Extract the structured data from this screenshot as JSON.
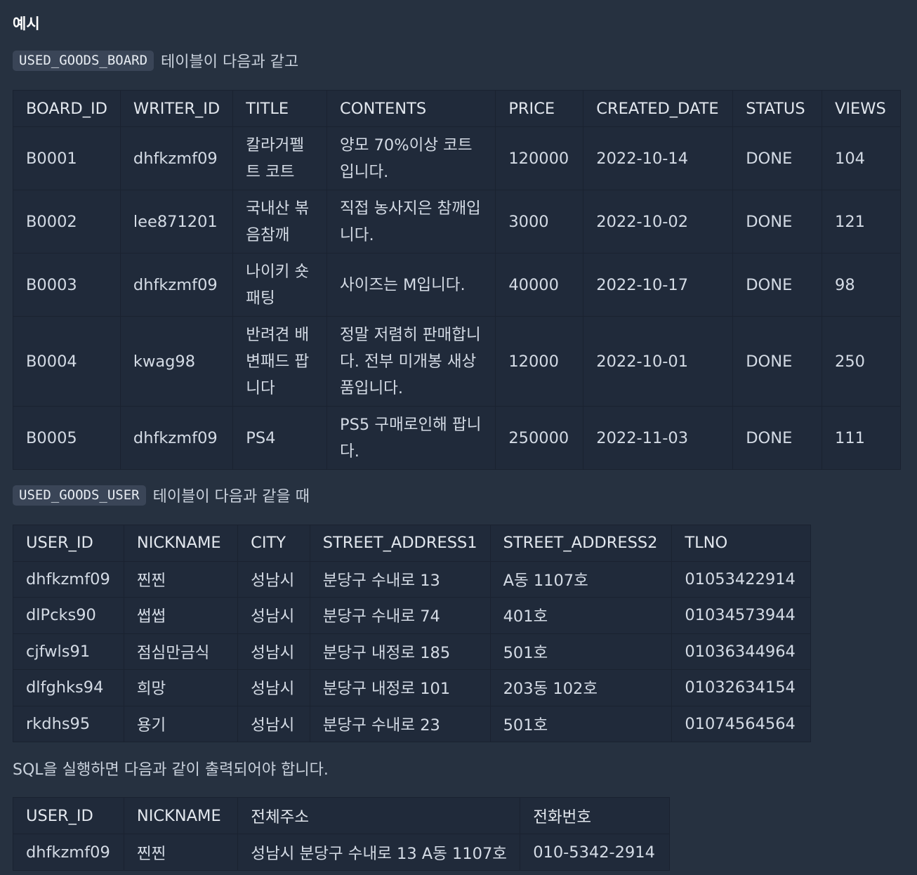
{
  "heading": "예시",
  "intro1": {
    "code": "USED_GOODS_BOARD",
    "text": "테이블이 다음과 같고"
  },
  "board_table": {
    "headers": [
      "BOARD_ID",
      "WRITER_ID",
      "TITLE",
      "CONTENTS",
      "PRICE",
      "CREATED_DATE",
      "STATUS",
      "VIEWS"
    ],
    "rows": [
      [
        "B0001",
        "dhfkzmf09",
        "칼라거펠트 코트",
        "양모 70%이상 코트입니다.",
        "120000",
        "2022-10-14",
        "DONE",
        "104"
      ],
      [
        "B0002",
        "lee871201",
        "국내산 볶음참깨",
        "직접 농사지은 참깨입니다.",
        "3000",
        "2022-10-02",
        "DONE",
        "121"
      ],
      [
        "B0003",
        "dhfkzmf09",
        "나이키 숏패팅",
        "사이즈는 M입니다.",
        "40000",
        "2022-10-17",
        "DONE",
        "98"
      ],
      [
        "B0004",
        "kwag98",
        "반려견 배변패드 팝니다",
        "정말 저렴히 판매합니다. 전부 미개봉 새상품입니다.",
        "12000",
        "2022-10-01",
        "DONE",
        "250"
      ],
      [
        "B0005",
        "dhfkzmf09",
        "PS4",
        "PS5 구매로인해 팝니다.",
        "250000",
        "2022-11-03",
        "DONE",
        "111"
      ]
    ]
  },
  "intro2": {
    "code": "USED_GOODS_USER",
    "text": "테이블이 다음과 같을 때"
  },
  "user_table": {
    "headers": [
      "USER_ID",
      "NICKNAME",
      "CITY",
      "STREET_ADDRESS1",
      "STREET_ADDRESS2",
      "TLNO"
    ],
    "rows": [
      [
        "dhfkzmf09",
        "찐찐",
        "성남시",
        "분당구 수내로 13",
        "A동 1107호",
        "01053422914"
      ],
      [
        "dlPcks90",
        "썹썹",
        "성남시",
        "분당구 수내로 74",
        "401호",
        "01034573944"
      ],
      [
        "cjfwls91",
        "점심만금식",
        "성남시",
        "분당구 내정로 185",
        "501호",
        "01036344964"
      ],
      [
        "dlfghks94",
        "희망",
        "성남시",
        "분당구 내정로 101",
        "203동 102호",
        "01032634154"
      ],
      [
        "rkdhs95",
        "용기",
        "성남시",
        "분당구 수내로 23",
        "501호",
        "01074564564"
      ]
    ]
  },
  "outro": "SQL을 실행하면 다음과 같이 출력되어야 합니다.",
  "result_table": {
    "headers": [
      "USER_ID",
      "NICKNAME",
      "전체주소",
      "전화번호"
    ],
    "rows": [
      [
        "dhfkzmf09",
        "찐찐",
        "성남시 분당구 수내로 13 A동 1107호",
        "010-5342-2914"
      ]
    ]
  }
}
